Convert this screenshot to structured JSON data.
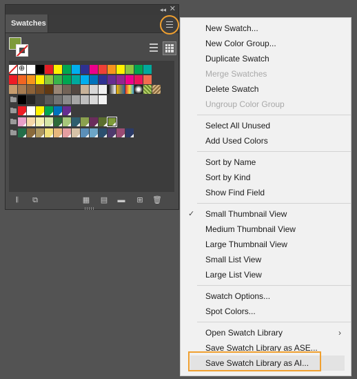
{
  "panel": {
    "tab_label": "Swatches",
    "collapse_glyph": "◂◂",
    "close_glyph": "✕",
    "fill_color": "#7e9b3a",
    "view_buttons": [
      "list-view",
      "thumbnail-view"
    ],
    "footer_icons": [
      "swatch-libraries-menu-icon",
      "place-swatches-icon",
      "show-swatch-kinds-icon",
      "swatch-options-icon",
      "new-color-group-icon",
      "new-swatch-icon",
      "delete-swatch-icon"
    ],
    "swatch_rows": [
      [
        "none",
        "registration",
        "#ffffff",
        "#000000",
        "#e51e25",
        "#fff200",
        "#00a651",
        "#00aeef",
        "#2e3192",
        "#ec008c",
        "#ee4036",
        "#f7941d",
        "#fff200",
        "#8dc63f",
        "#00a651",
        "#00a99d"
      ],
      [
        "#ee1c25",
        "#f26522",
        "#f7941d",
        "#fff200",
        "#8dc63f",
        "#39b54a",
        "#00a651",
        "#00a99d",
        "#00aeef",
        "#0072bc",
        "#2e3192",
        "#662d91",
        "#92278f",
        "#ec008c",
        "#ed145b",
        "#f26c4f"
      ],
      [
        "#c69c6d",
        "#a67c52",
        "#8c6239",
        "#754c24",
        "#603913",
        "#998675",
        "#736357",
        "#534741",
        "#c7b299",
        "#d7d7d7",
        "#f0f0f0",
        "grad-bw",
        "grad-orange",
        "grad-rainbow",
        "grad-radial",
        "pattern-green",
        "pattern-tan"
      ],
      [
        "folder",
        "#000000",
        "#262626",
        "#404040",
        "#595959",
        "#737373",
        "#8c8c8c",
        "#a6a6a6",
        "#bfbfbf",
        "#d9d9d9",
        "#f2f2f2"
      ],
      [
        "folder",
        "#ed1c24",
        "#ffffff",
        "#fff200",
        "#00a651",
        "#0072bc",
        "#662d91"
      ],
      [
        "folder",
        "#e9a0c9",
        "#f5d7a8",
        "#f3efb0",
        "#d5e6a6",
        "#2e6b3a",
        "#a7c77b",
        "#2f5e6e",
        "#8aa04e",
        "#6b2d5c",
        "#5b6e2f",
        "#7e9b3a"
      ],
      [
        "folder",
        "#236e49",
        "#8a6b3c",
        "#b09a62",
        "#f2e07a",
        "#e7b77e",
        "#e59ea1",
        "#d7c3a8",
        "#5b8fb8",
        "#6ca6c7",
        "#2b4f6e",
        "#4e3a6d",
        "#9a4c74",
        "#2c3b67"
      ]
    ]
  },
  "menu": {
    "groups": [
      [
        {
          "label": "New Swatch...",
          "enabled": true
        },
        {
          "label": "New Color Group...",
          "enabled": true
        },
        {
          "label": "Duplicate Swatch",
          "enabled": true
        },
        {
          "label": "Merge Swatches",
          "enabled": false
        },
        {
          "label": "Delete Swatch",
          "enabled": true
        },
        {
          "label": "Ungroup Color Group",
          "enabled": false
        }
      ],
      [
        {
          "label": "Select All Unused",
          "enabled": true
        },
        {
          "label": "Add Used Colors",
          "enabled": true
        }
      ],
      [
        {
          "label": "Sort by Name",
          "enabled": true
        },
        {
          "label": "Sort by Kind",
          "enabled": true
        },
        {
          "label": "Show Find Field",
          "enabled": true
        }
      ],
      [
        {
          "label": "Small Thumbnail View",
          "enabled": true,
          "checked": true
        },
        {
          "label": "Medium Thumbnail View",
          "enabled": true
        },
        {
          "label": "Large Thumbnail View",
          "enabled": true
        },
        {
          "label": "Small List View",
          "enabled": true
        },
        {
          "label": "Large List View",
          "enabled": true
        }
      ],
      [
        {
          "label": "Swatch Options...",
          "enabled": true
        },
        {
          "label": "Spot Colors...",
          "enabled": true
        }
      ],
      [
        {
          "label": "Open Swatch Library",
          "enabled": true,
          "submenu": true
        },
        {
          "label": "Save Swatch Library as ASE...",
          "enabled": true
        },
        {
          "label": "Save Swatch Library as AI...",
          "enabled": true,
          "hovered": true
        }
      ]
    ],
    "check_glyph": "✓",
    "submenu_glyph": "›"
  },
  "accent_color": "#f0a030"
}
